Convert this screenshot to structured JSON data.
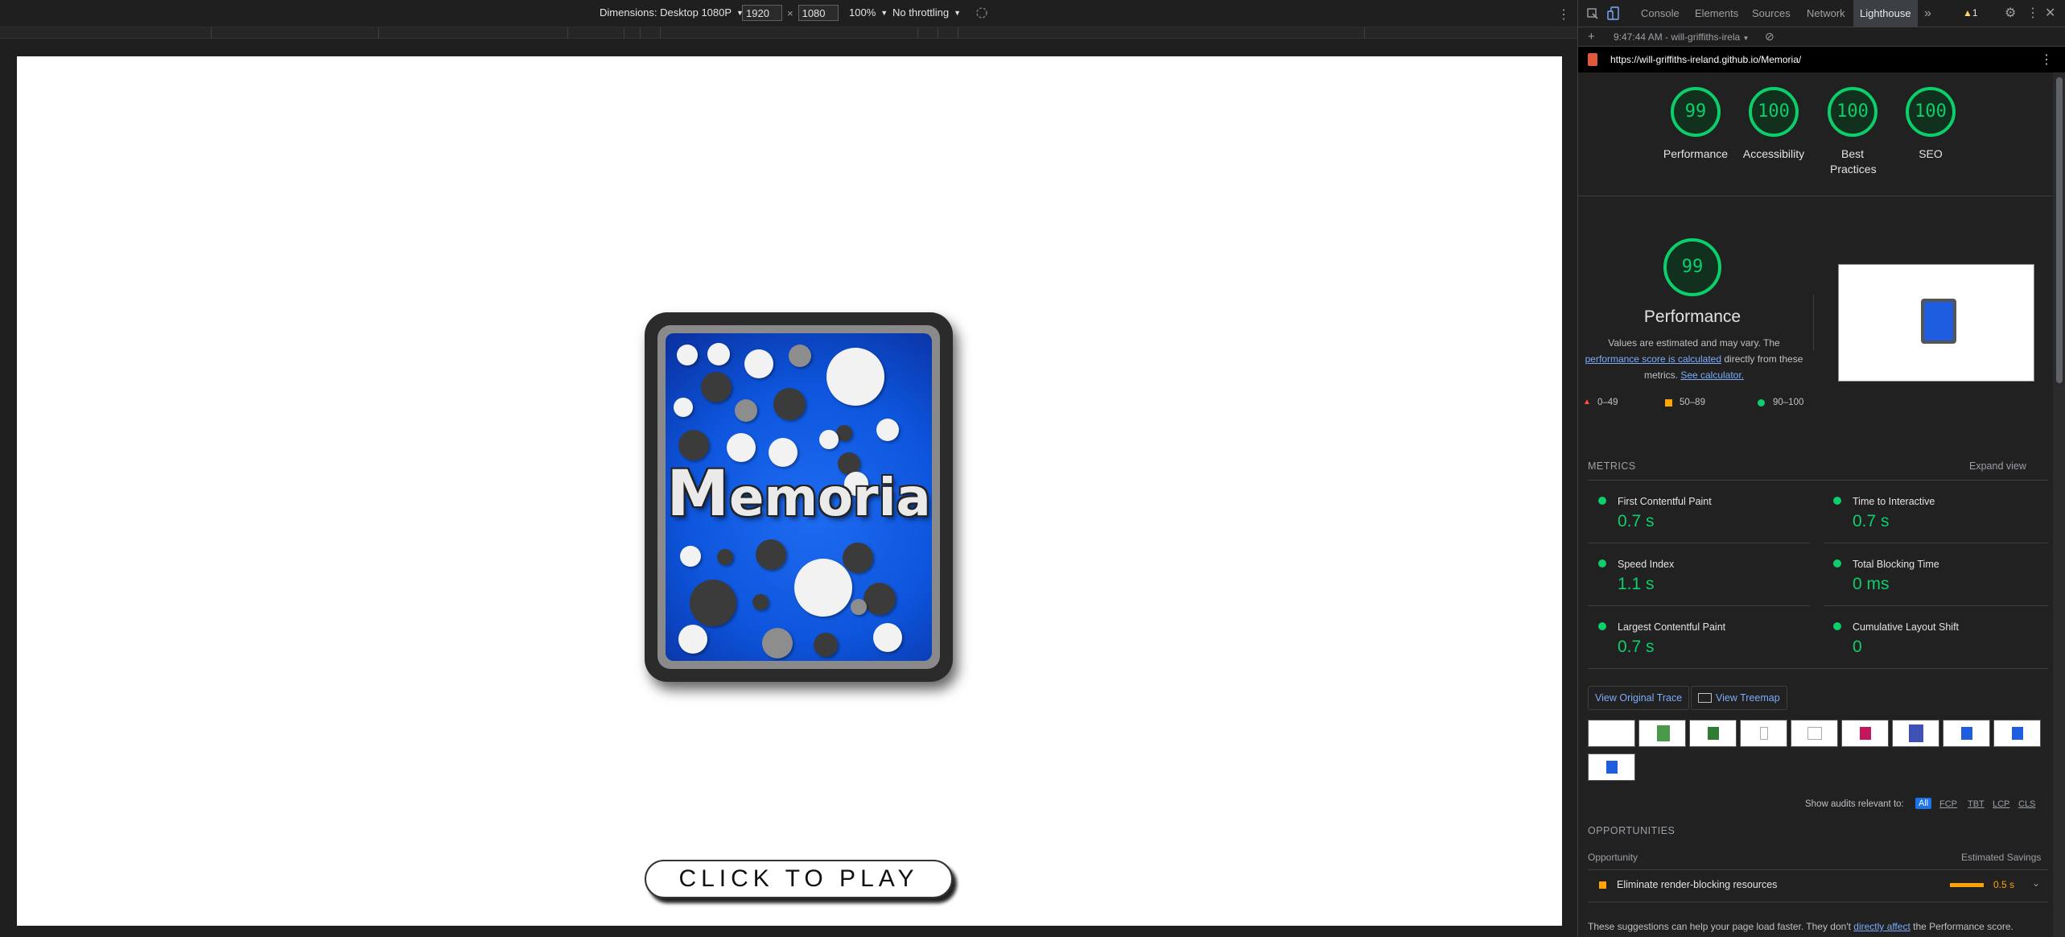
{
  "device_toolbar": {
    "dimensions_label": "Dimensions: Desktop 1080P",
    "width": "1920",
    "times": "×",
    "height": "1080",
    "zoom": "100%",
    "throttling": "No throttling"
  },
  "game": {
    "title_initial": "M",
    "title_rest": "emoria",
    "play_button": "CLICK TO PLAY"
  },
  "devtools": {
    "tabs": [
      "Console",
      "Elements",
      "Sources",
      "Network",
      "Lighthouse"
    ],
    "active_tab": "Lighthouse",
    "warnings_count": "1",
    "report_time": "9:47:44 AM - will-griffiths-irela",
    "url": "https://will-griffiths-ireland.github.io/Memoria/"
  },
  "scores": [
    {
      "value": "99",
      "label": "Performance"
    },
    {
      "value": "100",
      "label": "Accessibility"
    },
    {
      "value": "100",
      "label": "Best Practices"
    },
    {
      "value": "100",
      "label": "SEO"
    }
  ],
  "performance": {
    "score": "99",
    "title": "Performance",
    "desc_1": "Values are estimated and may vary. The",
    "desc_link_1": "performance score is calculated",
    "desc_2": "directly from these",
    "desc_3": "metrics.",
    "desc_link_2": "See calculator.",
    "legend": [
      {
        "range": "0–49",
        "color": "#ff4e42"
      },
      {
        "range": "50–89",
        "color": "#ffa400"
      },
      {
        "range": "90–100",
        "color": "#0cce6b"
      }
    ]
  },
  "metrics": {
    "heading": "METRICS",
    "expand": "Expand view",
    "items": [
      {
        "label": "First Contentful Paint",
        "value": "0.7 s"
      },
      {
        "label": "Time to Interactive",
        "value": "0.7 s"
      },
      {
        "label": "Speed Index",
        "value": "1.1 s"
      },
      {
        "label": "Total Blocking Time",
        "value": "0 ms"
      },
      {
        "label": "Largest Contentful Paint",
        "value": "0.7 s"
      },
      {
        "label": "Cumulative Layout Shift",
        "value": "0"
      }
    ]
  },
  "buttons": {
    "view_trace": "View Original Trace",
    "view_treemap": "View Treemap"
  },
  "audits_filter": {
    "label": "Show audits relevant to:",
    "options": [
      "All",
      "FCP",
      "TBT",
      "LCP",
      "CLS"
    ]
  },
  "opportunities": {
    "heading": "OPPORTUNITIES",
    "col_opportunity": "Opportunity",
    "col_savings": "Estimated Savings",
    "item_label": "Eliminate render-blocking resources",
    "item_savings": "0.5 s",
    "footer_1": "These suggestions can help your page load faster. They don't",
    "footer_link": "directly affect",
    "footer_2": "the Performance score."
  },
  "colors": {
    "pass": "#0cce6b",
    "average": "#ffa400",
    "fail": "#ff4e42",
    "link": "#7cacf8"
  }
}
